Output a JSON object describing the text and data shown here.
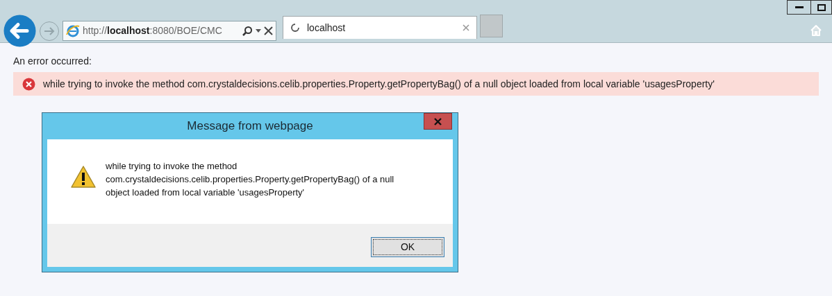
{
  "browser": {
    "address": "http://**localhost**:8080/BOE/CMC",
    "tabs": [
      {
        "label": "localhost",
        "selected": true,
        "loading": true
      }
    ]
  },
  "page": {
    "heading": "An error occurred:",
    "error_message": "while trying to invoke the method com.crystaldecisions.celib.properties.Property.getPropertyBag() of a null object loaded from local variable 'usagesProperty'"
  },
  "dialog": {
    "title": "Message from webpage",
    "message": "while trying to invoke the method com.crystaldecisions.celib.properties.Property.getPropertyBag() of a null object loaded from local variable 'usagesProperty'",
    "buttons": [
      "OK"
    ]
  }
}
